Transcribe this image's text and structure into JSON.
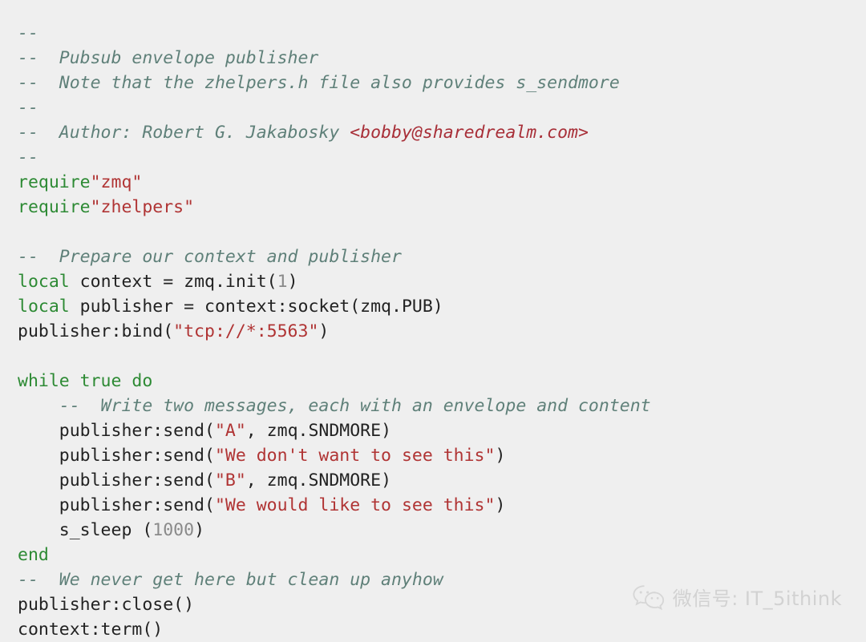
{
  "page": {
    "background_color": "#efefef",
    "language": "lua"
  },
  "colors": {
    "comment": "#5f8079",
    "comment_link": "#a82f38",
    "keyword": "#2d8a34",
    "string": "#b03434",
    "number": "#8a8a8a",
    "plain": "#222222",
    "watermark": "#d2d2d2"
  },
  "code": {
    "lines": [
      {
        "tokens": [
          {
            "t": "comment",
            "v": "--"
          }
        ]
      },
      {
        "tokens": [
          {
            "t": "comment",
            "v": "--  Pubsub envelope publisher"
          }
        ]
      },
      {
        "tokens": [
          {
            "t": "comment",
            "v": "--  Note that the zhelpers.h file also provides s_sendmore"
          }
        ]
      },
      {
        "tokens": [
          {
            "t": "comment",
            "v": "--"
          }
        ]
      },
      {
        "tokens": [
          {
            "t": "comment",
            "v": "--  Author: Robert G. Jakabosky "
          },
          {
            "t": "comment-link",
            "v": "<bobby@sharedrealm.com>"
          }
        ]
      },
      {
        "tokens": [
          {
            "t": "comment",
            "v": "--"
          }
        ]
      },
      {
        "tokens": [
          {
            "t": "keyword",
            "v": "require"
          },
          {
            "t": "string",
            "v": "\"zmq\""
          }
        ]
      },
      {
        "tokens": [
          {
            "t": "keyword",
            "v": "require"
          },
          {
            "t": "string",
            "v": "\"zhelpers\""
          }
        ]
      },
      {
        "tokens": []
      },
      {
        "tokens": [
          {
            "t": "comment",
            "v": "--  Prepare our context and publisher"
          }
        ]
      },
      {
        "tokens": [
          {
            "t": "keyword",
            "v": "local"
          },
          {
            "t": "plain",
            "v": " context = zmq.init("
          },
          {
            "t": "number",
            "v": "1"
          },
          {
            "t": "plain",
            "v": ")"
          }
        ]
      },
      {
        "tokens": [
          {
            "t": "keyword",
            "v": "local"
          },
          {
            "t": "plain",
            "v": " publisher = context:socket(zmq.PUB)"
          }
        ]
      },
      {
        "tokens": [
          {
            "t": "plain",
            "v": "publisher:bind("
          },
          {
            "t": "string",
            "v": "\"tcp://*:5563\""
          },
          {
            "t": "plain",
            "v": ")"
          }
        ]
      },
      {
        "tokens": []
      },
      {
        "tokens": [
          {
            "t": "keyword",
            "v": "while true do"
          }
        ]
      },
      {
        "tokens": [
          {
            "t": "comment",
            "v": "    --  Write two messages, each with an envelope and content"
          }
        ]
      },
      {
        "tokens": [
          {
            "t": "plain",
            "v": "    publisher:send("
          },
          {
            "t": "string",
            "v": "\"A\""
          },
          {
            "t": "plain",
            "v": ", zmq.SNDMORE)"
          }
        ]
      },
      {
        "tokens": [
          {
            "t": "plain",
            "v": "    publisher:send("
          },
          {
            "t": "string",
            "v": "\"We don't want to see this\""
          },
          {
            "t": "plain",
            "v": ")"
          }
        ]
      },
      {
        "tokens": [
          {
            "t": "plain",
            "v": "    publisher:send("
          },
          {
            "t": "string",
            "v": "\"B\""
          },
          {
            "t": "plain",
            "v": ", zmq.SNDMORE)"
          }
        ]
      },
      {
        "tokens": [
          {
            "t": "plain",
            "v": "    publisher:send("
          },
          {
            "t": "string",
            "v": "\"We would like to see this\""
          },
          {
            "t": "plain",
            "v": ")"
          }
        ]
      },
      {
        "tokens": [
          {
            "t": "plain",
            "v": "    s_sleep ("
          },
          {
            "t": "number",
            "v": "1000"
          },
          {
            "t": "plain",
            "v": ")"
          }
        ]
      },
      {
        "tokens": [
          {
            "t": "keyword",
            "v": "end"
          }
        ]
      },
      {
        "tokens": [
          {
            "t": "comment",
            "v": "--  We never get here but clean up anyhow"
          }
        ]
      },
      {
        "tokens": [
          {
            "t": "plain",
            "v": "publisher:close()"
          }
        ]
      },
      {
        "tokens": [
          {
            "t": "plain",
            "v": "context:term()"
          }
        ]
      }
    ]
  },
  "watermark": {
    "icon": "wechat-logo-icon",
    "text": "微信号: IT_5ithink"
  }
}
